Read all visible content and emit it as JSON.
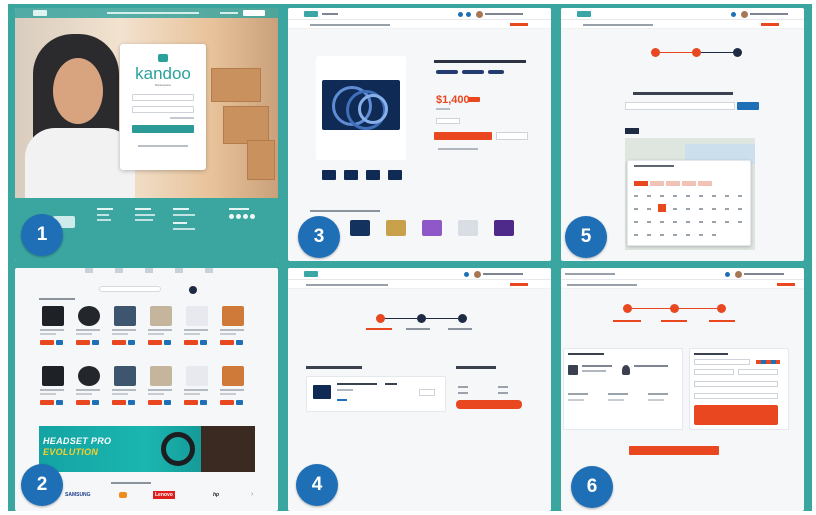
{
  "badges": [
    "1",
    "2",
    "3",
    "4",
    "5",
    "6"
  ],
  "brand_color": "#3ba6a0",
  "badge_color": "#1f6fb6",
  "accent_color": "#e8471f",
  "login": {
    "logo_text": "kandoo",
    "logo_tagline": "Marketplace"
  },
  "product": {
    "price": "$1,400"
  },
  "home": {
    "banner_line1": "HEADSET PRO",
    "banner_line2": "EVOLUTION",
    "brands": [
      {
        "name": "SAMSUNG",
        "color": "#1d3f8a"
      },
      {
        "name": "Lenovo",
        "color": "#e01e1e"
      },
      {
        "name": "hp",
        "color": "#1d1d1d"
      }
    ]
  },
  "icons": [
    "kandoo-logo-icon",
    "cart-icon",
    "user-avatar-icon",
    "calendar-icon",
    "headphones-icon"
  ]
}
